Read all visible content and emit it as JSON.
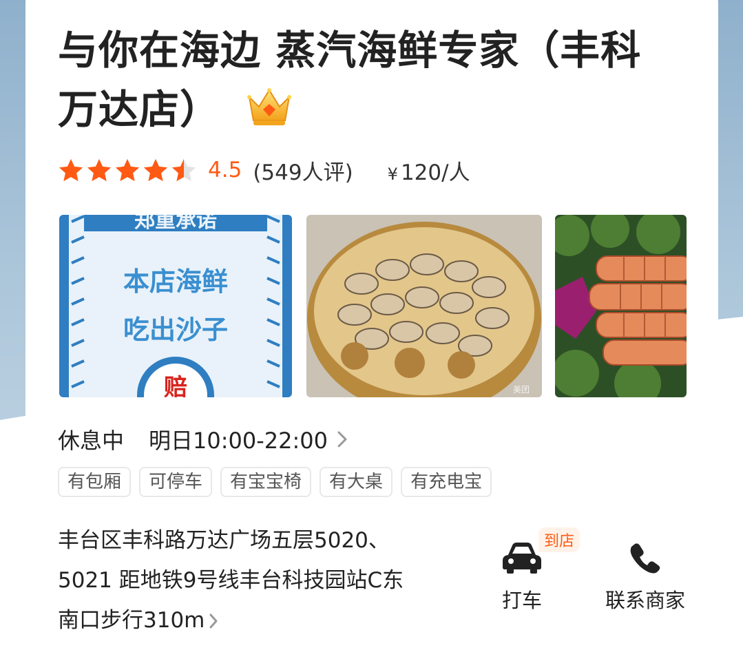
{
  "shop": {
    "name": "与你在海边 蒸汽海鲜专家（丰科万达店）",
    "badge_icon": "crown-icon",
    "rating": 4.5,
    "rating_text": "4.5",
    "reviews_text": "(549人评)",
    "price_symbol": "¥",
    "price_text": "120/人"
  },
  "photos": [
    {
      "icon": "promo-poster",
      "lines": [
        "郑重承诺",
        "本店海鲜",
        "吃出沙子"
      ],
      "stamp": "赔"
    },
    {
      "icon": "steamed-clams-photo"
    },
    {
      "icon": "mantis-shrimp-photo"
    }
  ],
  "hours": {
    "status": "休息中",
    "next": "明日10:00-22:00"
  },
  "tags": [
    "有包厢",
    "可停车",
    "有宝宝椅",
    "有大桌",
    "有充电宝"
  ],
  "address": {
    "line1": "丰台区丰科路万达广场五层5020、",
    "line2": "5021 距地铁9号线丰台科技园站C东",
    "line3": "南口步行310m"
  },
  "actions": {
    "taxi_label": "打车",
    "taxi_badge": "到店",
    "contact_label": "联系商家"
  },
  "colors": {
    "accent": "#ff5a14",
    "background_blue": "#a8c3d8"
  }
}
